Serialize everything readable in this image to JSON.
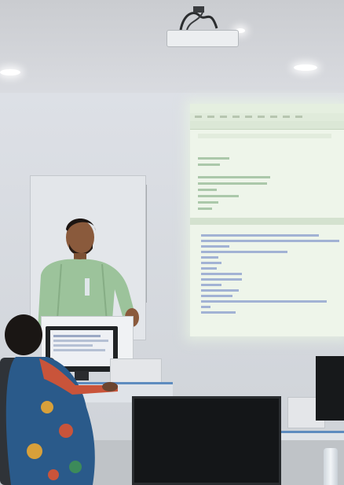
{
  "scene": {
    "description_tag": "classroom-lecture-photo"
  },
  "colors": {
    "projection_glow": "#eef5ea",
    "code_green": "#2f7a3b",
    "console_blue": "#6f86c4",
    "shirt_green": "#9cc39b",
    "desk_trim": "#5e8cbf"
  }
}
